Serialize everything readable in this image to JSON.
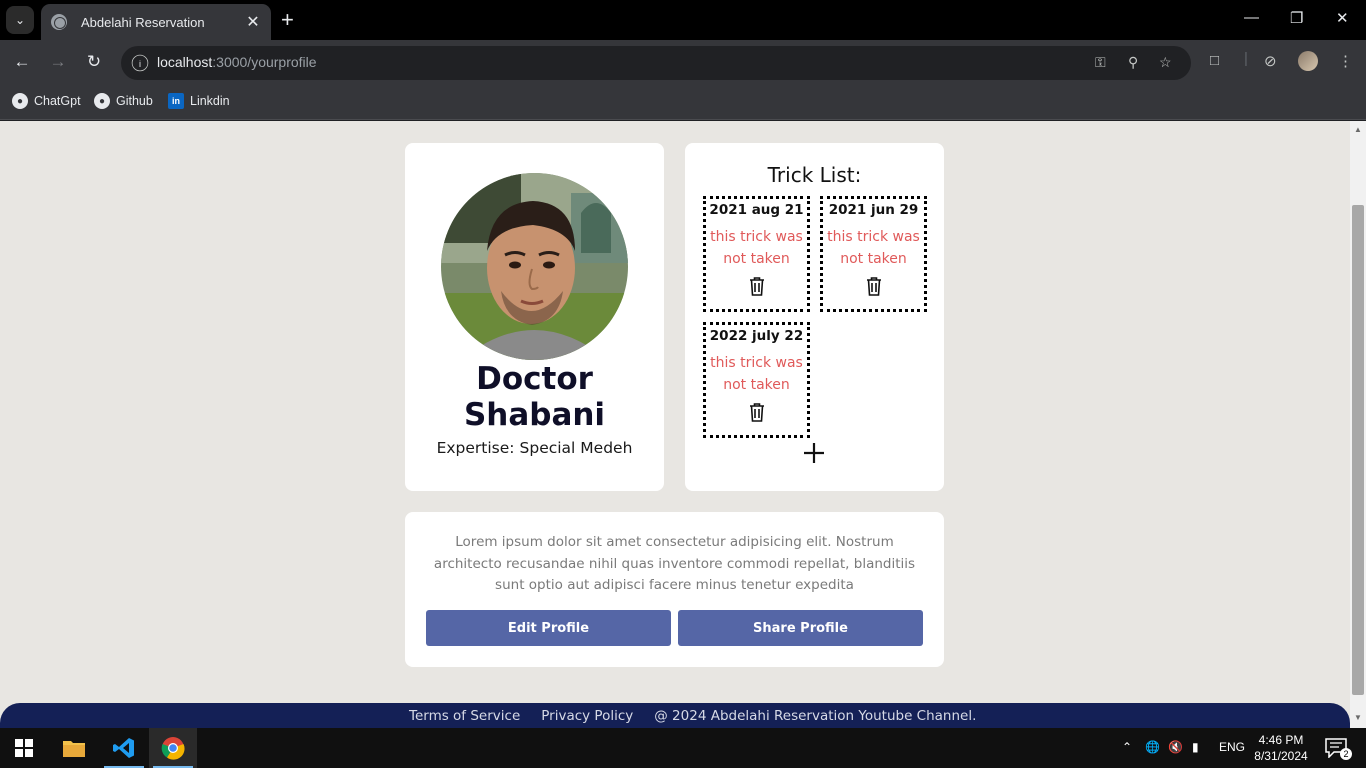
{
  "browser": {
    "tab_title": "Abdelahi Reservation",
    "url_host": "localhost",
    "url_path": ":3000/yourprofile",
    "bookmarks": [
      "ChatGpt",
      "Github",
      "Linkdin"
    ]
  },
  "profile": {
    "name_line1": "Doctor",
    "name_line2": "Shabani",
    "expertise_label": "Expertise:",
    "expertise_value": "Special Medeh"
  },
  "tricks": {
    "title": "Trick List:",
    "items": [
      {
        "date": "2021 aug 21",
        "status": "this trick was not taken"
      },
      {
        "date": "2021 jun 29",
        "status": "this trick was not taken"
      },
      {
        "date": "2022 july 22",
        "status": "this trick was not taken"
      }
    ]
  },
  "bio": {
    "text": "Lorem ipsum dolor sit amet consectetur adipisicing elit. Nostrum architecto recusandae nihil quas inventore commodi repellat, blanditiis sunt optio aut adipisci facere minus tenetur expedita",
    "edit_label": "Edit Profile",
    "share_label": "Share Profile"
  },
  "footer": {
    "terms": "Terms of Service",
    "privacy": "Privacy Policy",
    "copyright": "@ 2024 Abdelahi Reservation Youtube Channel."
  },
  "taskbar": {
    "language": "ENG",
    "time": "4:46 PM",
    "date": "8/31/2024",
    "notification_count": "2"
  },
  "colors": {
    "accent_button": "#5566a6",
    "footer_bg": "#142056",
    "status_text": "#e05a5a",
    "page_bg": "#e8e6e2"
  }
}
